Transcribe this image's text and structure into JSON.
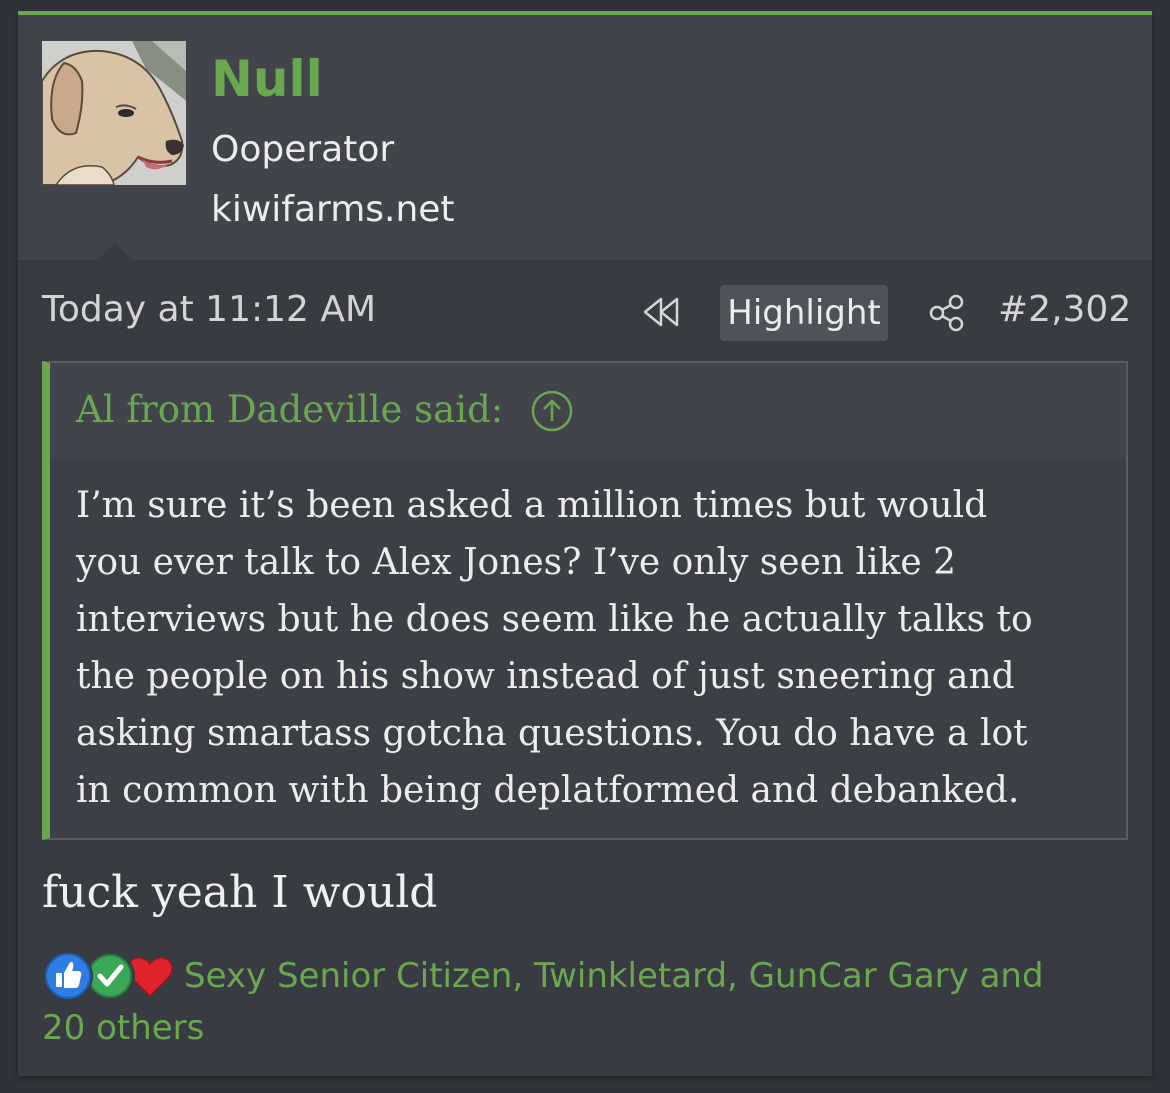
{
  "user": {
    "name": "Null",
    "title": "Ooperator",
    "site": "kiwifarms.net",
    "avatar_icon": "dog-avatar"
  },
  "post": {
    "date": "Today at 11:12 AM",
    "highlight_label": "Highlight",
    "number": "#2,302",
    "rewind_icon": "rewind-icon",
    "share_icon": "share-icon"
  },
  "quote": {
    "attribution": "Al from Dadeville said:",
    "lines": [
      "I’m sure it’s been asked a million times but would",
      "you ever talk to Alex Jones? I’ve only seen like 2",
      "interviews but he does seem like he actually talks to",
      "the people on his show instead of just sneering and",
      "asking smartass gotcha questions. You do have a lot",
      "in common with being deplatformed and debanked."
    ]
  },
  "reply": {
    "text": "fuck yeah I would"
  },
  "reactions": {
    "icons": [
      "like-icon",
      "check-icon",
      "heart-icon"
    ],
    "users_line": "Sexy Senior Citizen, Twinkletard, GunCar Gary and",
    "others_line": "20 others"
  },
  "colors": {
    "accent": "#6aa84f",
    "background": "#383b42",
    "header_bg": "#41444b",
    "text": "#ececec"
  }
}
